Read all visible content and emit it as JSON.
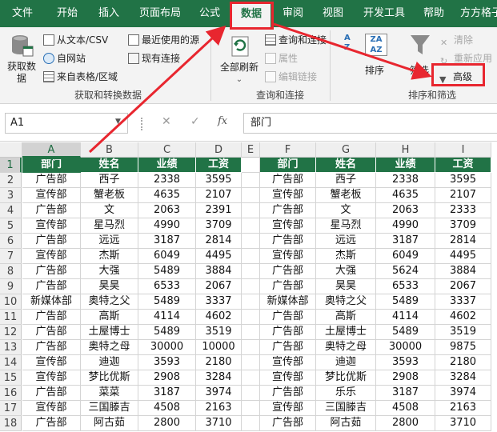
{
  "tabs": [
    {
      "label": "文件",
      "active": false
    },
    {
      "label": "开始",
      "active": false
    },
    {
      "label": "插入",
      "active": false
    },
    {
      "label": "页面布局",
      "active": false
    },
    {
      "label": "公式",
      "active": false
    },
    {
      "label": "数据",
      "active": true
    },
    {
      "label": "审阅",
      "active": false
    },
    {
      "label": "视图",
      "active": false
    },
    {
      "label": "开发工具",
      "active": false
    },
    {
      "label": "帮助",
      "active": false
    },
    {
      "label": "方方格子",
      "active": false
    }
  ],
  "ribbon": {
    "get_data": "获取数据",
    "from_text_csv": "从文本/CSV",
    "from_web": "自网站",
    "from_table": "来自表格/区域",
    "recent_sources": "最近使用的源",
    "existing_connections": "现有连接",
    "group_get_transform": "获取和转换数据",
    "refresh_all": "全部刷新",
    "queries_connections": "查询和连接",
    "properties": "属性",
    "edit_links": "编辑链接",
    "group_queries": "查询和连接",
    "sort": "排序",
    "filter": "筛选",
    "clear": "清除",
    "reapply": "重新应用",
    "advanced": "高级",
    "group_sort_filter": "排序和筛选"
  },
  "formula_bar": {
    "name_box": "A1",
    "fx": "fx",
    "content": "部门"
  },
  "columns": [
    "A",
    "B",
    "C",
    "D",
    "E",
    "F",
    "G",
    "H",
    "I"
  ],
  "selected_column": "A",
  "selected_row": 1,
  "rows": [
    "1",
    "2",
    "3",
    "4",
    "5",
    "6",
    "7",
    "8",
    "9",
    "10",
    "11",
    "12",
    "13",
    "14",
    "15",
    "16",
    "17",
    "18"
  ],
  "left_table": {
    "headers": [
      "部门",
      "姓名",
      "业绩",
      "工资"
    ],
    "rows": [
      [
        "广告部",
        "西子",
        "2338",
        "3595"
      ],
      [
        "宣传部",
        "蟹老板",
        "4635",
        "2107"
      ],
      [
        "广告部",
        "文",
        "2063",
        "2391"
      ],
      [
        "宣传部",
        "星马烈",
        "4990",
        "3709"
      ],
      [
        "广告部",
        "远远",
        "3187",
        "2814"
      ],
      [
        "宣传部",
        "杰斯",
        "6049",
        "4495"
      ],
      [
        "广告部",
        "大强",
        "5489",
        "3884"
      ],
      [
        "广告部",
        "昊昊",
        "6533",
        "2067"
      ],
      [
        "新媒体部",
        "奥特之父",
        "5489",
        "3337"
      ],
      [
        "广告部",
        "高斯",
        "4114",
        "4602"
      ],
      [
        "广告部",
        "土屋博士",
        "5489",
        "3519"
      ],
      [
        "广告部",
        "奥特之母",
        "30000",
        "10000"
      ],
      [
        "宣传部",
        "迪迦",
        "3593",
        "2180"
      ],
      [
        "宣传部",
        "梦比优斯",
        "2908",
        "3284"
      ],
      [
        "广告部",
        "菜菜",
        "3187",
        "3974"
      ],
      [
        "宣传部",
        "三国滕吉",
        "4508",
        "2163"
      ],
      [
        "广告部",
        "阿古茹",
        "2800",
        "3710"
      ]
    ]
  },
  "right_table": {
    "headers": [
      "部门",
      "姓名",
      "业绩",
      "工资"
    ],
    "rows": [
      [
        "广告部",
        "西子",
        "2338",
        "3595"
      ],
      [
        "宣传部",
        "蟹老板",
        "4635",
        "2107"
      ],
      [
        "广告部",
        "文",
        "2063",
        "2333"
      ],
      [
        "宣传部",
        "星马烈",
        "4990",
        "3709"
      ],
      [
        "广告部",
        "远远",
        "3187",
        "2814"
      ],
      [
        "宣传部",
        "杰斯",
        "6049",
        "4495"
      ],
      [
        "广告部",
        "大强",
        "5624",
        "3884"
      ],
      [
        "广告部",
        "昊昊",
        "6533",
        "2067"
      ],
      [
        "新媒体部",
        "奥特之父",
        "5489",
        "3337"
      ],
      [
        "广告部",
        "高斯",
        "4114",
        "4602"
      ],
      [
        "广告部",
        "土屋博士",
        "5489",
        "3519"
      ],
      [
        "广告部",
        "奥特之母",
        "30000",
        "9875"
      ],
      [
        "宣传部",
        "迪迦",
        "3593",
        "2180"
      ],
      [
        "宣传部",
        "梦比优斯",
        "2908",
        "3284"
      ],
      [
        "广告部",
        "乐乐",
        "3187",
        "3974"
      ],
      [
        "宣传部",
        "三国滕吉",
        "4508",
        "2163"
      ],
      [
        "广告部",
        "阿古茹",
        "2800",
        "3710"
      ]
    ]
  },
  "colors": {
    "excel_green": "#217346",
    "annotation_red": "#e8262f"
  }
}
